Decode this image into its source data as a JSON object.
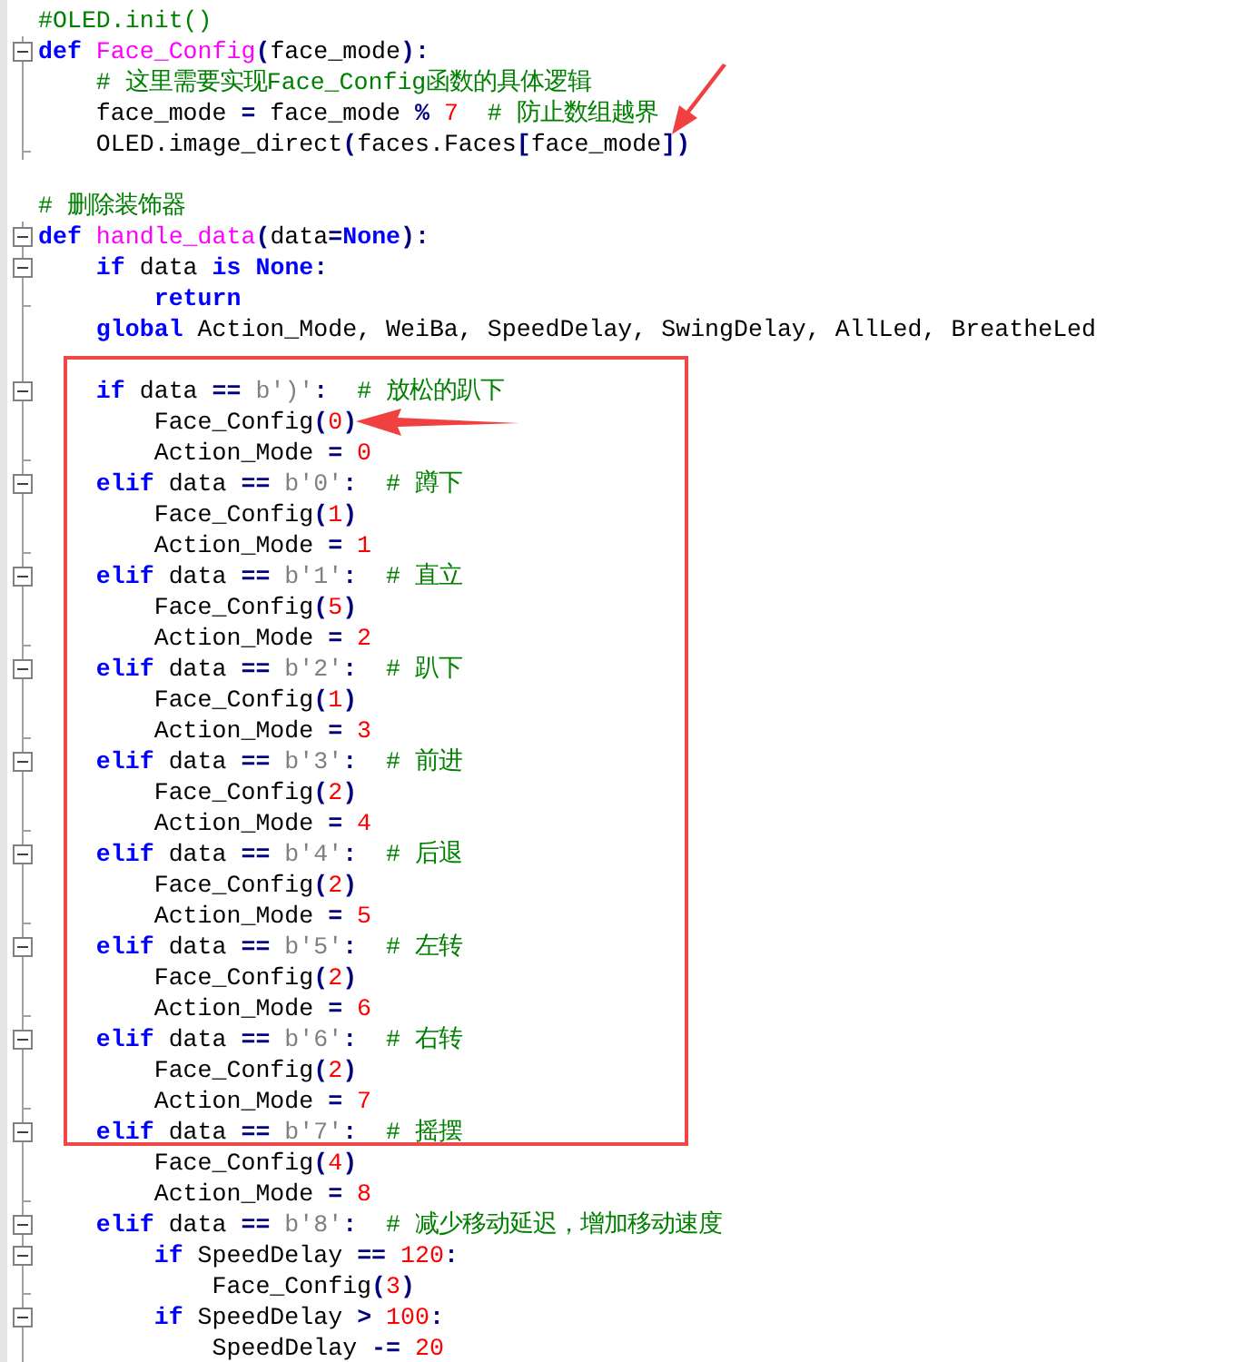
{
  "editor": {
    "lines": [
      {
        "kind": "plain",
        "tokens": [
          {
            "kind": "comment",
            "text": "#OLED.init()"
          }
        ]
      },
      {
        "kind": "open",
        "tokens": [
          {
            "kind": "keyword",
            "text": "def"
          },
          {
            "kind": "name",
            "text": " Face_Config"
          },
          {
            "kind": "operator",
            "text": "("
          },
          {
            "kind": "plain",
            "text": "face_mode"
          },
          {
            "kind": "operator",
            "text": "):"
          }
        ]
      },
      {
        "kind": "body",
        "tokens": [
          {
            "kind": "comment",
            "text": "    # 这里需要实现Face_Config函数的具体逻辑"
          }
        ]
      },
      {
        "kind": "body",
        "tokens": [
          {
            "kind": "plain",
            "text": "    face_mode "
          },
          {
            "kind": "operator",
            "text": "="
          },
          {
            "kind": "plain",
            "text": " face_mode "
          },
          {
            "kind": "operator",
            "text": "%"
          },
          {
            "kind": "number",
            "text": " 7"
          },
          {
            "kind": "comment",
            "text": "  # 防止数组越界"
          }
        ]
      },
      {
        "kind": "end",
        "tokens": [
          {
            "kind": "plain",
            "text": "    OLED.image_direct"
          },
          {
            "kind": "operator",
            "text": "("
          },
          {
            "kind": "plain",
            "text": "faces.Faces"
          },
          {
            "kind": "operator",
            "text": "["
          },
          {
            "kind": "plain",
            "text": "face_mode"
          },
          {
            "kind": "operator",
            "text": "])"
          }
        ]
      },
      {
        "kind": "plain"
      },
      {
        "kind": "plain",
        "tokens": [
          {
            "kind": "comment",
            "text": "# 删除装饰器"
          }
        ]
      },
      {
        "kind": "open",
        "tokens": [
          {
            "kind": "keyword",
            "text": "def"
          },
          {
            "kind": "name",
            "text": " handle_data"
          },
          {
            "kind": "operator",
            "text": "("
          },
          {
            "kind": "plain",
            "text": "data"
          },
          {
            "kind": "operator",
            "text": "="
          },
          {
            "kind": "keyword",
            "text": "None"
          },
          {
            "kind": "operator",
            "text": "):"
          }
        ]
      },
      {
        "kind": "open",
        "tokens": [
          {
            "kind": "keyword",
            "text": "    if"
          },
          {
            "kind": "plain",
            "text": " data "
          },
          {
            "kind": "keyword",
            "text": "is"
          },
          {
            "kind": "keyword",
            "text": " None"
          },
          {
            "kind": "operator",
            "text": ":"
          }
        ]
      },
      {
        "kind": "end",
        "tokens": [
          {
            "kind": "keyword",
            "text": "        return"
          }
        ]
      },
      {
        "kind": "body",
        "tokens": [
          {
            "kind": "keyword",
            "text": "    global"
          },
          {
            "kind": "plain",
            "text": " Action_Mode, WeiBa, SpeedDelay, SwingDelay, AllLed, BreatheLed"
          }
        ]
      },
      {
        "kind": "body"
      },
      {
        "kind": "open",
        "tokens": [
          {
            "kind": "keyword",
            "text": "    if"
          },
          {
            "kind": "plain",
            "text": " data "
          },
          {
            "kind": "operator",
            "text": "=="
          },
          {
            "kind": "string",
            "text": " b')'"
          },
          {
            "kind": "operator",
            "text": ":"
          },
          {
            "kind": "comment",
            "text": "  # 放松的趴下"
          }
        ]
      },
      {
        "kind": "body",
        "tokens": [
          {
            "kind": "plain",
            "text": "        Face_Config"
          },
          {
            "kind": "operator",
            "text": "("
          },
          {
            "kind": "number",
            "text": "0"
          },
          {
            "kind": "operator",
            "text": ")"
          }
        ]
      },
      {
        "kind": "end",
        "tokens": [
          {
            "kind": "plain",
            "text": "        Action_Mode "
          },
          {
            "kind": "operator",
            "text": "="
          },
          {
            "kind": "number",
            "text": " 0"
          }
        ]
      },
      {
        "kind": "open",
        "tokens": [
          {
            "kind": "keyword",
            "text": "    elif"
          },
          {
            "kind": "plain",
            "text": " data "
          },
          {
            "kind": "operator",
            "text": "=="
          },
          {
            "kind": "string",
            "text": " b'0'"
          },
          {
            "kind": "operator",
            "text": ":"
          },
          {
            "kind": "comment",
            "text": "  # 蹲下"
          }
        ]
      },
      {
        "kind": "body",
        "tokens": [
          {
            "kind": "plain",
            "text": "        Face_Config"
          },
          {
            "kind": "operator",
            "text": "("
          },
          {
            "kind": "number",
            "text": "1"
          },
          {
            "kind": "operator",
            "text": ")"
          }
        ]
      },
      {
        "kind": "end",
        "tokens": [
          {
            "kind": "plain",
            "text": "        Action_Mode "
          },
          {
            "kind": "operator",
            "text": "="
          },
          {
            "kind": "number",
            "text": " 1"
          }
        ]
      },
      {
        "kind": "open",
        "tokens": [
          {
            "kind": "keyword",
            "text": "    elif"
          },
          {
            "kind": "plain",
            "text": " data "
          },
          {
            "kind": "operator",
            "text": "=="
          },
          {
            "kind": "string",
            "text": " b'1'"
          },
          {
            "kind": "operator",
            "text": ":"
          },
          {
            "kind": "comment",
            "text": "  # 直立"
          }
        ]
      },
      {
        "kind": "body",
        "tokens": [
          {
            "kind": "plain",
            "text": "        Face_Config"
          },
          {
            "kind": "operator",
            "text": "("
          },
          {
            "kind": "number",
            "text": "5"
          },
          {
            "kind": "operator",
            "text": ")"
          }
        ]
      },
      {
        "kind": "end",
        "tokens": [
          {
            "kind": "plain",
            "text": "        Action_Mode "
          },
          {
            "kind": "operator",
            "text": "="
          },
          {
            "kind": "number",
            "text": " 2"
          }
        ]
      },
      {
        "kind": "open",
        "tokens": [
          {
            "kind": "keyword",
            "text": "    elif"
          },
          {
            "kind": "plain",
            "text": " data "
          },
          {
            "kind": "operator",
            "text": "=="
          },
          {
            "kind": "string",
            "text": " b'2'"
          },
          {
            "kind": "operator",
            "text": ":"
          },
          {
            "kind": "comment",
            "text": "  # 趴下"
          }
        ]
      },
      {
        "kind": "body",
        "tokens": [
          {
            "kind": "plain",
            "text": "        Face_Config"
          },
          {
            "kind": "operator",
            "text": "("
          },
          {
            "kind": "number",
            "text": "1"
          },
          {
            "kind": "operator",
            "text": ")"
          }
        ]
      },
      {
        "kind": "end",
        "tokens": [
          {
            "kind": "plain",
            "text": "        Action_Mode "
          },
          {
            "kind": "operator",
            "text": "="
          },
          {
            "kind": "number",
            "text": " 3"
          }
        ]
      },
      {
        "kind": "open",
        "tokens": [
          {
            "kind": "keyword",
            "text": "    elif"
          },
          {
            "kind": "plain",
            "text": " data "
          },
          {
            "kind": "operator",
            "text": "=="
          },
          {
            "kind": "string",
            "text": " b'3'"
          },
          {
            "kind": "operator",
            "text": ":"
          },
          {
            "kind": "comment",
            "text": "  # 前进"
          }
        ]
      },
      {
        "kind": "body",
        "tokens": [
          {
            "kind": "plain",
            "text": "        Face_Config"
          },
          {
            "kind": "operator",
            "text": "("
          },
          {
            "kind": "number",
            "text": "2"
          },
          {
            "kind": "operator",
            "text": ")"
          }
        ]
      },
      {
        "kind": "end",
        "tokens": [
          {
            "kind": "plain",
            "text": "        Action_Mode "
          },
          {
            "kind": "operator",
            "text": "="
          },
          {
            "kind": "number",
            "text": " 4"
          }
        ]
      },
      {
        "kind": "open",
        "tokens": [
          {
            "kind": "keyword",
            "text": "    elif"
          },
          {
            "kind": "plain",
            "text": " data "
          },
          {
            "kind": "operator",
            "text": "=="
          },
          {
            "kind": "string",
            "text": " b'4'"
          },
          {
            "kind": "operator",
            "text": ":"
          },
          {
            "kind": "comment",
            "text": "  # 后退"
          }
        ]
      },
      {
        "kind": "body",
        "tokens": [
          {
            "kind": "plain",
            "text": "        Face_Config"
          },
          {
            "kind": "operator",
            "text": "("
          },
          {
            "kind": "number",
            "text": "2"
          },
          {
            "kind": "operator",
            "text": ")"
          }
        ]
      },
      {
        "kind": "end",
        "tokens": [
          {
            "kind": "plain",
            "text": "        Action_Mode "
          },
          {
            "kind": "operator",
            "text": "="
          },
          {
            "kind": "number",
            "text": " 5"
          }
        ]
      },
      {
        "kind": "open",
        "tokens": [
          {
            "kind": "keyword",
            "text": "    elif"
          },
          {
            "kind": "plain",
            "text": " data "
          },
          {
            "kind": "operator",
            "text": "=="
          },
          {
            "kind": "string",
            "text": " b'5'"
          },
          {
            "kind": "operator",
            "text": ":"
          },
          {
            "kind": "comment",
            "text": "  # 左转"
          }
        ]
      },
      {
        "kind": "body",
        "tokens": [
          {
            "kind": "plain",
            "text": "        Face_Config"
          },
          {
            "kind": "operator",
            "text": "("
          },
          {
            "kind": "number",
            "text": "2"
          },
          {
            "kind": "operator",
            "text": ")"
          }
        ]
      },
      {
        "kind": "end",
        "tokens": [
          {
            "kind": "plain",
            "text": "        Action_Mode "
          },
          {
            "kind": "operator",
            "text": "="
          },
          {
            "kind": "number",
            "text": " 6"
          }
        ]
      },
      {
        "kind": "open",
        "tokens": [
          {
            "kind": "keyword",
            "text": "    elif"
          },
          {
            "kind": "plain",
            "text": " data "
          },
          {
            "kind": "operator",
            "text": "=="
          },
          {
            "kind": "string",
            "text": " b'6'"
          },
          {
            "kind": "operator",
            "text": ":"
          },
          {
            "kind": "comment",
            "text": "  # 右转"
          }
        ]
      },
      {
        "kind": "body",
        "tokens": [
          {
            "kind": "plain",
            "text": "        Face_Config"
          },
          {
            "kind": "operator",
            "text": "("
          },
          {
            "kind": "number",
            "text": "2"
          },
          {
            "kind": "operator",
            "text": ")"
          }
        ]
      },
      {
        "kind": "end",
        "tokens": [
          {
            "kind": "plain",
            "text": "        Action_Mode "
          },
          {
            "kind": "operator",
            "text": "="
          },
          {
            "kind": "number",
            "text": " 7"
          }
        ]
      },
      {
        "kind": "open",
        "tokens": [
          {
            "kind": "keyword",
            "text": "    elif"
          },
          {
            "kind": "plain",
            "text": " data "
          },
          {
            "kind": "operator",
            "text": "=="
          },
          {
            "kind": "string",
            "text": " b'7'"
          },
          {
            "kind": "operator",
            "text": ":"
          },
          {
            "kind": "comment",
            "text": "  # 摇摆"
          }
        ]
      },
      {
        "kind": "body",
        "tokens": [
          {
            "kind": "plain",
            "text": "        Face_Config"
          },
          {
            "kind": "operator",
            "text": "("
          },
          {
            "kind": "number",
            "text": "4"
          },
          {
            "kind": "operator",
            "text": ")"
          }
        ]
      },
      {
        "kind": "end",
        "tokens": [
          {
            "kind": "plain",
            "text": "        Action_Mode "
          },
          {
            "kind": "operator",
            "text": "="
          },
          {
            "kind": "number",
            "text": " 8"
          }
        ]
      },
      {
        "kind": "open",
        "tokens": [
          {
            "kind": "keyword",
            "text": "    elif"
          },
          {
            "kind": "plain",
            "text": " data "
          },
          {
            "kind": "operator",
            "text": "=="
          },
          {
            "kind": "string",
            "text": " b'8'"
          },
          {
            "kind": "operator",
            "text": ":"
          },
          {
            "kind": "comment",
            "text": "  # 减少移动延迟，增加移动速度"
          }
        ]
      },
      {
        "kind": "open",
        "tokens": [
          {
            "kind": "keyword",
            "text": "        if"
          },
          {
            "kind": "plain",
            "text": " SpeedDelay "
          },
          {
            "kind": "operator",
            "text": "=="
          },
          {
            "kind": "number",
            "text": " 120"
          },
          {
            "kind": "operator",
            "text": ":"
          }
        ]
      },
      {
        "kind": "end",
        "tokens": [
          {
            "kind": "plain",
            "text": "            Face_Config"
          },
          {
            "kind": "operator",
            "text": "("
          },
          {
            "kind": "number",
            "text": "3"
          },
          {
            "kind": "operator",
            "text": ")"
          }
        ]
      },
      {
        "kind": "open",
        "tokens": [
          {
            "kind": "keyword",
            "text": "        if"
          },
          {
            "kind": "plain",
            "text": " SpeedDelay "
          },
          {
            "kind": "operator",
            "text": ">"
          },
          {
            "kind": "number",
            "text": " 100"
          },
          {
            "kind": "operator",
            "text": ":"
          }
        ]
      },
      {
        "kind": "body",
        "tokens": [
          {
            "kind": "plain",
            "text": "            SpeedDelay "
          },
          {
            "kind": "operator",
            "text": "-="
          },
          {
            "kind": "number",
            "text": " 20"
          }
        ]
      }
    ]
  }
}
